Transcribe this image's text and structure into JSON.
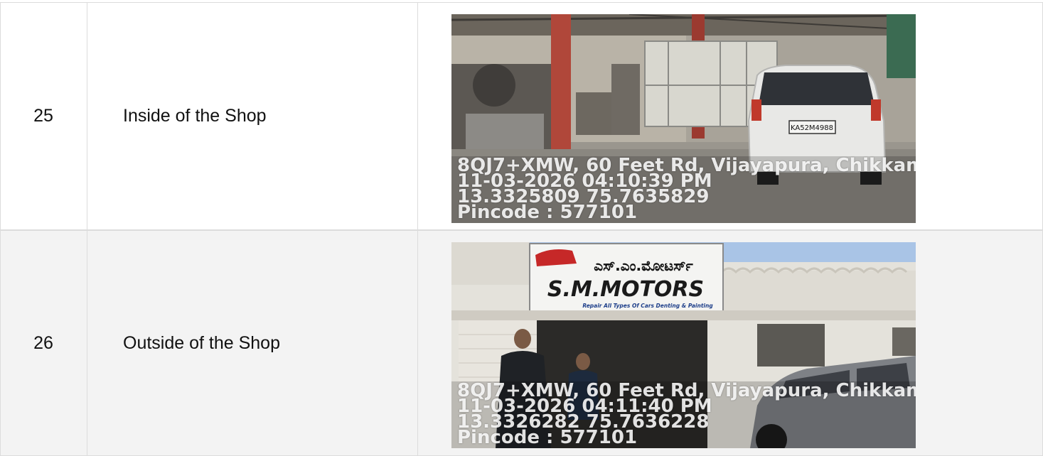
{
  "rows": [
    {
      "number": "25",
      "label": "Inside of the Shop",
      "photo": {
        "subject": "workshop interior with white car",
        "overlay": {
          "line1": "8QJ7+XMW, 60 Feet Rd, Vijayapura, Chikkam",
          "line2": "11-03-2026 04:10:39 PM",
          "line3": "13.3325809 75.7635829",
          "line4": "Pincode : 577101"
        },
        "plate": "KA52M4988"
      }
    },
    {
      "number": "26",
      "label": "Outside of the Shop",
      "photo": {
        "subject": "shop frontage with signboard",
        "sign": {
          "kannada": "ಎಸ್.ಎಂ.ಮೋಟರ್ಸ್",
          "brand": "S.M.MOTORS",
          "tagline": "Repair All Types Of Cars Denting & Painting"
        },
        "overlay": {
          "line1": "8QJ7+XMW, 60 Feet Rd, Vijayapura, Chikkam",
          "line2": "11-03-2026 04:11:40 PM",
          "line3": "13.3326282 75.7636228",
          "line4": "Pincode : 577101"
        }
      }
    }
  ],
  "colors": {
    "row_odd": "#ffffff",
    "row_even": "#f3f3f3",
    "border": "#dcdcdc",
    "text": "#111111"
  }
}
